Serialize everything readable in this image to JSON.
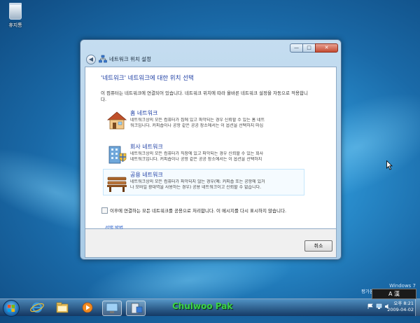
{
  "desktop": {
    "recycle_bin_label": "휴지통"
  },
  "window": {
    "title": "네트워크 위치 설정",
    "heading": "'네트워크' 네트워크에 대한 위치 선택",
    "description": "이 컴퓨터는 네트워크에 연결되어 있습니다. 네트워크 위치에 따라 올바른 네트워크 설정을 자동으로 적용합니다.",
    "options": [
      {
        "title": "홈 네트워크",
        "line1": "네트워크상의 모든 컴퓨터가 집에 있고 파악되는 경우 신뢰할 수 있는 홈 네트",
        "line2": "워크입니다. 커피숍이나 공항 같은 공공 장소에서는 이 옵션을 선택하지 마십",
        "icon": "home-network-icon"
      },
      {
        "title": "회사 네트워크",
        "line1": "네트워크상의 모든 컴퓨터가 직장에 있고 파악되는 경우 신뢰할 수 있는 회사",
        "line2": "네트워크입니다. 커피숍이나 공항 같은 공공 장소에서는 이 옵션을 선택하지",
        "icon": "work-network-icon"
      },
      {
        "title": "공용 네트워크",
        "line1": "네트워크상의 모든 컴퓨터가 파악되지 않는 경우(예: 커피숍 또는 공항에 있거",
        "line2": "나 모바일 광대역을 사용하는 경우) 공용 네트워크이고 신뢰할 수 없습니다.",
        "icon": "public-network-icon"
      }
    ],
    "checkbox_label": "이후에 연결하는 모든 네트워크를 공용으로 처리합니다. 이 메시지를 다시 표시하지 않습니다.",
    "help_link": "선택 방법",
    "cancel_label": "취소",
    "caption_buttons": {
      "minimize": "—",
      "maximize": "□",
      "close": "✕"
    }
  },
  "watermark": {
    "brand": "Windows 7",
    "build": "평가본입니다. 빌드 7068.w"
  },
  "taskbar": {
    "label": "Chulwoo Pak",
    "tray_lang": "A 漢",
    "time": "오후 8:21",
    "date": "2009-04-02"
  },
  "colors": {
    "heading": "#1e3fa4",
    "link": "#1e58c8",
    "taskbar_label": "#3ad246"
  }
}
